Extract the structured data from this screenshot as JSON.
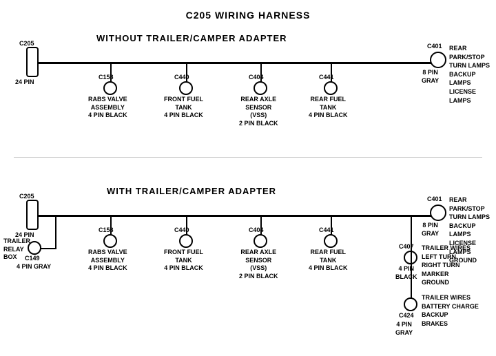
{
  "title": "C205 WIRING HARNESS",
  "section1": {
    "label": "WITHOUT  TRAILER/CAMPER  ADAPTER",
    "left_connector": {
      "id": "C205",
      "pin": "24 PIN"
    },
    "right_connector": {
      "id": "C401",
      "pin": "8 PIN\nGRAY",
      "labels": "REAR PARK/STOP\nTURN LAMPS\nBACKUP LAMPS\nLICENSE LAMPS"
    },
    "connectors": [
      {
        "id": "C158",
        "label": "RABS VALVE\nASSEMBLY\n4 PIN BLACK"
      },
      {
        "id": "C440",
        "label": "FRONT FUEL\nTANK\n4 PIN BLACK"
      },
      {
        "id": "C404",
        "label": "REAR AXLE\nSENSOR\n(VSS)\n2 PIN BLACK"
      },
      {
        "id": "C441",
        "label": "REAR FUEL\nTANK\n4 PIN BLACK"
      }
    ]
  },
  "section2": {
    "label": "WITH  TRAILER/CAMPER  ADAPTER",
    "left_connector": {
      "id": "C205",
      "pin": "24 PIN"
    },
    "right_connector": {
      "id": "C401",
      "pin": "8 PIN\nGRAY",
      "labels": "REAR PARK/STOP\nTURN LAMPS\nBACKUP LAMPS\nLICENSE LAMPS\nGROUND"
    },
    "connectors": [
      {
        "id": "C158",
        "label": "RABS VALVE\nASSEMBLY\n4 PIN BLACK"
      },
      {
        "id": "C440",
        "label": "FRONT FUEL\nTANK\n4 PIN BLACK"
      },
      {
        "id": "C404",
        "label": "REAR AXLE\nSENSOR\n(VSS)\n2 PIN BLACK"
      },
      {
        "id": "C441",
        "label": "REAR FUEL\nTANK\n4 PIN BLACK"
      }
    ],
    "extra_left": {
      "label": "TRAILER\nRELAY\nBOX",
      "id": "C149",
      "pin": "4 PIN GRAY"
    },
    "extra_right": [
      {
        "id": "C407",
        "pin": "4 PIN\nBLACK",
        "label": "TRAILER WIRES\nLEFT TURN\nRIGHT TURN\nMARKER\nGROUND"
      },
      {
        "id": "C424",
        "pin": "4 PIN\nGRAY",
        "label": "TRAILER WIRES\nBATTERY CHARGE\nBACKUP\nBRAKES"
      }
    ]
  }
}
